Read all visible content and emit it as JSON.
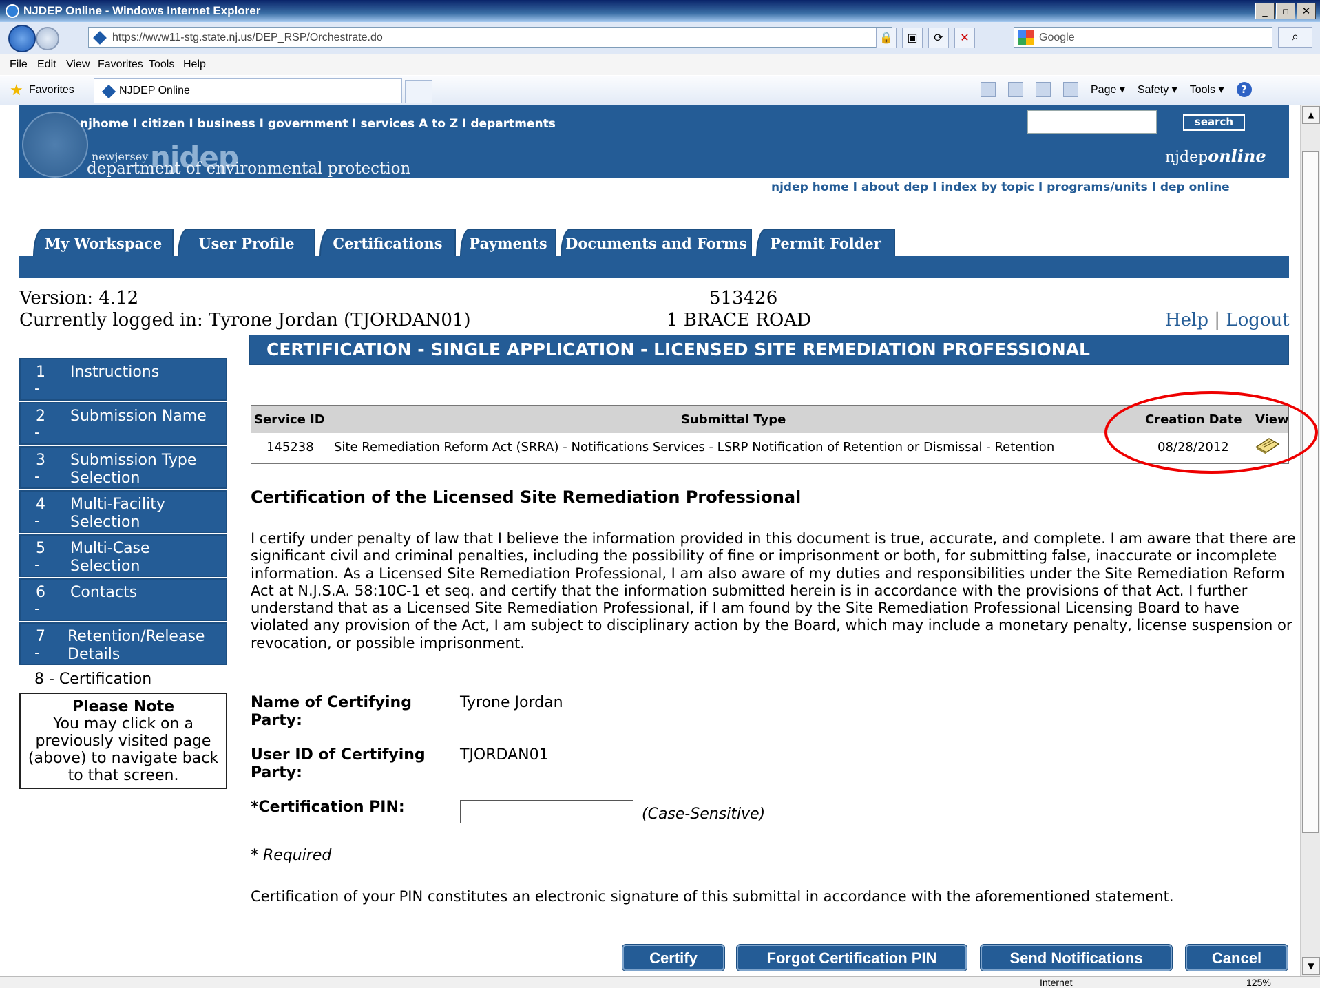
{
  "browser": {
    "title": "NJDEP Online - Windows Internet Explorer",
    "url": "https://www11-stg.state.nj.us/DEP_RSP/Orchestrate.do",
    "search_placeholder": "Google",
    "menu": [
      "File",
      "Edit",
      "View",
      "Favorites",
      "Tools",
      "Help"
    ],
    "favorites_label": "Favorites",
    "tab_title": "NJDEP Online",
    "cmd": {
      "page": "Page ▾",
      "safety": "Safety ▾",
      "tools": "Tools ▾"
    },
    "status": {
      "zone": "Internet",
      "zoom": "125%"
    }
  },
  "header": {
    "topnav": "njhome  I  citizen  I  business  I  government  I  services A to Z  I  departments",
    "logo_small": "newjersey",
    "logo_big": "njdep",
    "logo_line": "department of environmental protection",
    "search_button": "search",
    "brand": "njdep",
    "brand_suffix": "online",
    "subnav": "njdep home  I  about dep  I  index by topic  I  programs/units  I  dep online"
  },
  "tabs": [
    "My Workspace",
    "User Profile",
    "Certifications",
    "Payments",
    "Documents and Forms",
    "Permit Folder"
  ],
  "info": {
    "version": "Version: 4.12",
    "logged_in": "Currently logged in: Tyrone Jordan (TJORDAN01)",
    "site_id": "513426",
    "site_address": "1 BRACE ROAD",
    "help": "Help",
    "sep": "|",
    "logout": "Logout"
  },
  "page_title": "CERTIFICATION - SINGLE APPLICATION - LICENSED SITE REMEDIATION PROFESSIONAL",
  "steps": [
    {
      "num": "1",
      "line1": "Instructions",
      "line2": ""
    },
    {
      "num": "2",
      "line1": "Submission Name",
      "line2": ""
    },
    {
      "num": "3",
      "line1": "Submission Type",
      "line2": "Selection"
    },
    {
      "num": "4",
      "line1": "Multi-Facility",
      "line2": "Selection"
    },
    {
      "num": "5",
      "line1": "Multi-Case",
      "line2": "Selection"
    },
    {
      "num": "6",
      "line1": "Contacts",
      "line2": ""
    },
    {
      "num": "7",
      "line1": "Retention/Release",
      "line2": "Details"
    }
  ],
  "step_dash": "-",
  "current_step": "8  -  Certification",
  "note": {
    "heading": "Please Note",
    "body": "You may click on a previously visited page (above) to navigate back to that screen."
  },
  "table": {
    "headers": {
      "service_id": "Service ID",
      "submittal_type": "Submittal Type",
      "creation_date": "Creation Date",
      "view": "View"
    },
    "row": {
      "service_id": "145238",
      "submittal_type": "Site Remediation Reform Act (SRRA) - Notifications Services - LSRP Notification of Retention or Dismissal - Retention",
      "creation_date": "08/28/2012",
      "view_icon": "view-document-icon"
    }
  },
  "cert": {
    "heading": "Certification of the Licensed Site Remediation Professional",
    "body": "I certify under penalty of law that I believe the information provided in this document is true, accurate, and complete. I am aware that there are significant civil and criminal penalties, including the possibility of fine or imprisonment or both, for submitting false, inaccurate or incomplete information. As a Licensed Site Remediation Professional, I am also aware of my duties and responsibilities under the Site Remediation Reform Act at N.J.S.A. 58:10C-1 et seq. and certify that the information submitted herein is in accordance with the provisions of that Act. I further understand that as a Licensed Site Remediation Professional, if I am found by the Site Remediation Professional Licensing Board to have violated any provision of the Act, I am subject to disciplinary action by the Board, which may include a monetary penalty, license suspension or revocation, or possible imprisonment.",
    "name_label_1": "Name of Certifying",
    "name_label_2": "Party:",
    "name_value": "Tyrone Jordan",
    "userid_label_1": "User ID of Certifying",
    "userid_label_2": "Party:",
    "userid_value": "TJORDAN01",
    "pin_label": "*Certification PIN:",
    "pin_value": "",
    "pin_hint": "(Case-Sensitive)",
    "required": "* Required",
    "pin_note": "Certification of your PIN constitutes an electronic signature of this submittal in accordance with the aforementioned statement."
  },
  "buttons": {
    "certify": "Certify",
    "forgot": "Forgot Certification PIN",
    "send": "Send Notifications",
    "cancel": "Cancel"
  },
  "colors": {
    "brand_blue": "#245c96",
    "annotation_red": "#e00000"
  }
}
